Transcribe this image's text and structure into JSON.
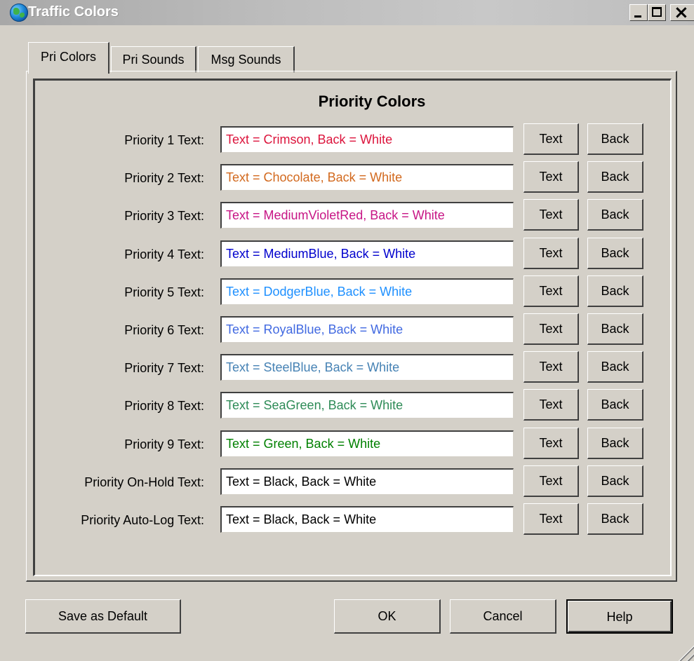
{
  "window": {
    "title": "Traffic Colors"
  },
  "tabs": [
    {
      "label": "Pri Colors",
      "active": true
    },
    {
      "label": "Pri Sounds",
      "active": false
    },
    {
      "label": "Msg Sounds",
      "active": false
    }
  ],
  "group_title": "Priority Colors",
  "rows": [
    {
      "label": "Priority 1 Text:",
      "value": "Text = Crimson, Back = White",
      "color": "#dc143c"
    },
    {
      "label": "Priority 2 Text:",
      "value": "Text = Chocolate, Back = White",
      "color": "#d2691e"
    },
    {
      "label": "Priority 3 Text:",
      "value": "Text = MediumVioletRed, Back = White",
      "color": "#c71585"
    },
    {
      "label": "Priority 4 Text:",
      "value": "Text = MediumBlue, Back = White",
      "color": "#0000cd"
    },
    {
      "label": "Priority 5 Text:",
      "value": "Text = DodgerBlue, Back = White",
      "color": "#1e90ff"
    },
    {
      "label": "Priority 6 Text:",
      "value": "Text = RoyalBlue, Back = White",
      "color": "#4169e1"
    },
    {
      "label": "Priority 7 Text:",
      "value": "Text = SteelBlue, Back = White",
      "color": "#4682b4"
    },
    {
      "label": "Priority 8 Text:",
      "value": "Text = SeaGreen, Back = White",
      "color": "#2e8b57"
    },
    {
      "label": "Priority 9 Text:",
      "value": "Text = Green, Back = White",
      "color": "#008000"
    },
    {
      "label": "Priority On-Hold Text:",
      "value": "Text = Black, Back = White",
      "color": "#000000"
    },
    {
      "label": "Priority Auto-Log Text:",
      "value": "Text = Black, Back = White",
      "color": "#000000"
    }
  ],
  "row_buttons": {
    "text": "Text",
    "back": "Back"
  },
  "footer": {
    "save_default": "Save as Default",
    "ok": "OK",
    "cancel": "Cancel",
    "help": "Help"
  }
}
